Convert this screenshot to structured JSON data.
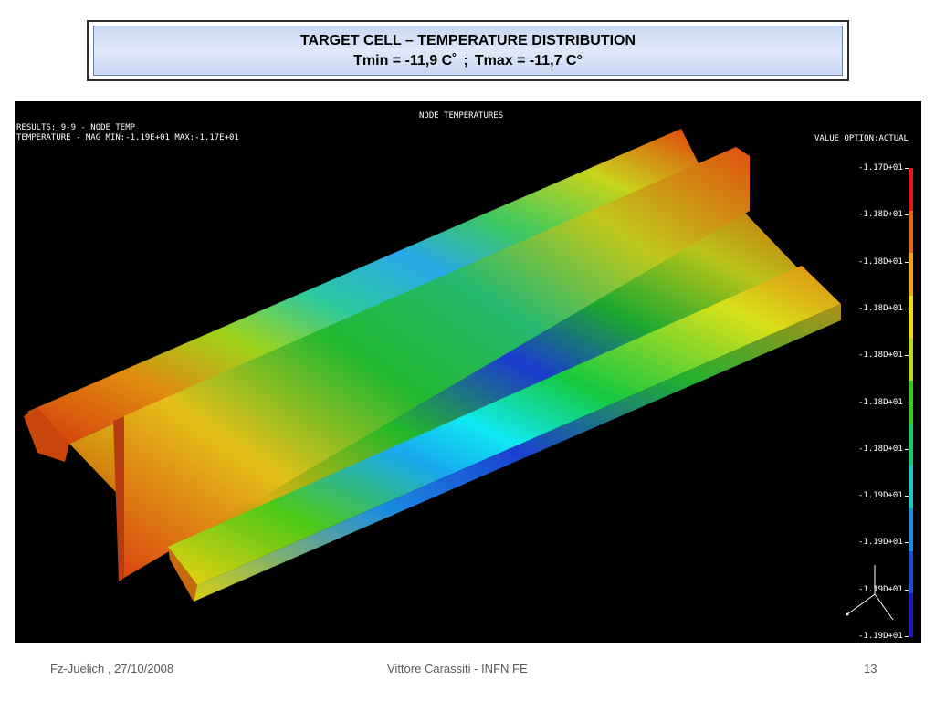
{
  "slide": {
    "title_line1": "TARGET CELL – TEMPERATURE DISTRIBUTION",
    "title_line2_a": "Tmin = -11,9 C˚",
    "title_line2_sep": ";",
    "title_line2_b": "Tmax = -11,7 C°"
  },
  "plot": {
    "header_center": "NODE TEMPERATURES",
    "results_line1": "RESULTS: 9-9 - NODE TEMP",
    "results_line2": "TEMPERATURE - MAG MIN:-1.19E+01 MAX:-1.17E+01",
    "value_option": "VALUE OPTION:ACTUAL",
    "legend_labels": [
      "-1.17D+01",
      "-1.18D+01",
      "-1.18D+01",
      "-1.18D+01",
      "-1.18D+01",
      "-1.18D+01",
      "-1.18D+01",
      "-1.19D+01",
      "-1.19D+01",
      "-1.19D+01",
      "-1.19D+01"
    ],
    "legend_colors": [
      "#e51a0e",
      "#e8641c",
      "#f0a21c",
      "#f2d81a",
      "#b8dc1c",
      "#2fcc16",
      "#18c86a",
      "#1ac8c0",
      "#1a8ce0",
      "#1a4ed8",
      "#1a18c8"
    ],
    "background_color": "#000000"
  },
  "footer": {
    "left": "Fz-Juelich , 27/10/2008",
    "center": "Vittore Carassiti - INFN FE",
    "right": "13"
  }
}
